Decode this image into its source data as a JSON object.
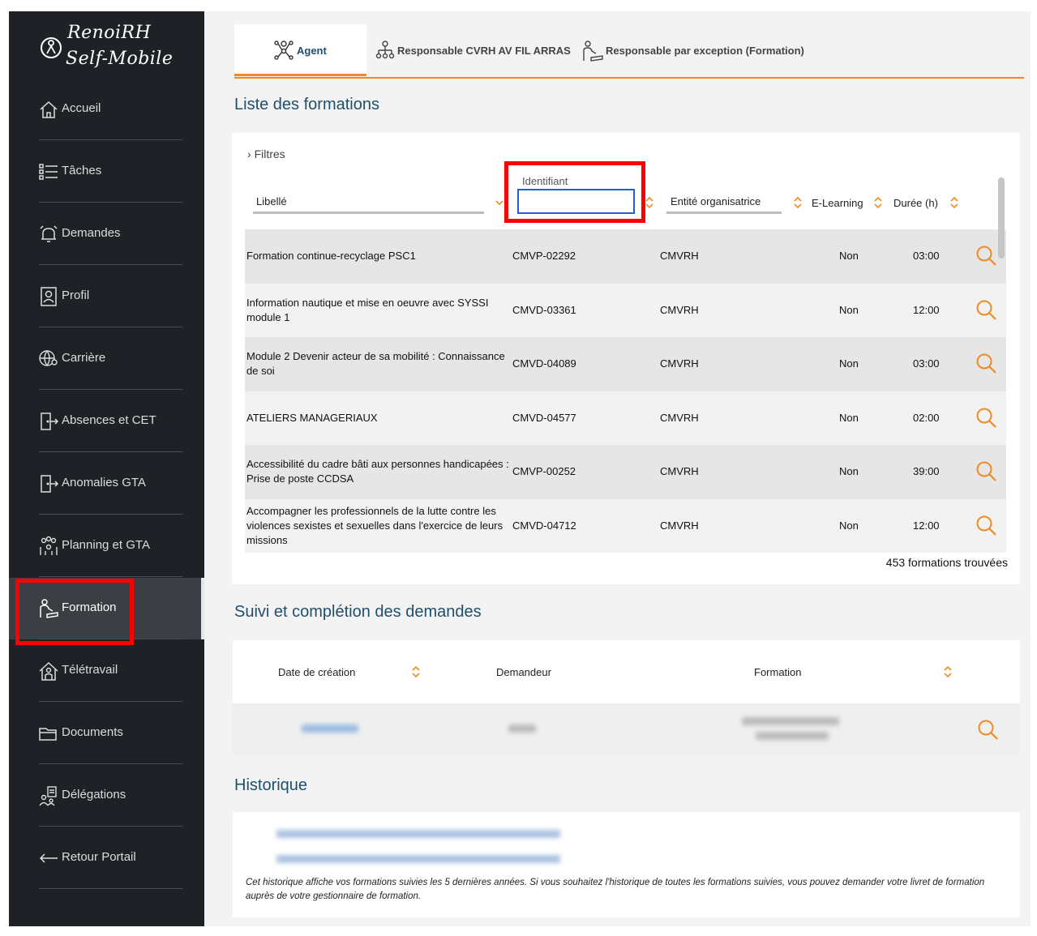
{
  "app": {
    "logo_line1": "RenoiRH",
    "logo_line2": "Self-Mobile"
  },
  "sidebar": {
    "items": [
      {
        "label": "Accueil",
        "icon": "home-icon"
      },
      {
        "label": "Tâches",
        "icon": "list-icon"
      },
      {
        "label": "Demandes",
        "icon": "bell-icon"
      },
      {
        "label": "Profil",
        "icon": "profile-icon"
      },
      {
        "label": "Carrière",
        "icon": "globe-user-icon"
      },
      {
        "label": "Absences et CET",
        "icon": "door-exit-icon"
      },
      {
        "label": "Anomalies GTA",
        "icon": "door-exit-icon"
      },
      {
        "label": "Planning et GTA",
        "icon": "group-icon"
      },
      {
        "label": "Formation",
        "icon": "person-study-icon"
      },
      {
        "label": "Télétravail",
        "icon": "home-person-icon"
      },
      {
        "label": "Documents",
        "icon": "folder-icon"
      },
      {
        "label": "Délégations",
        "icon": "delegation-icon"
      },
      {
        "label": "Retour Portail",
        "icon": "arrow-left-icon"
      }
    ],
    "active": "Formation"
  },
  "tabs": [
    {
      "label": "Agent",
      "active": true
    },
    {
      "label": "Responsable CVRH AV FIL ARRAS",
      "active": false
    },
    {
      "label": "Responsable par exception (Formation)",
      "active": false
    }
  ],
  "formations": {
    "title": "Liste des formations",
    "filters_label": "Filtres",
    "columns": {
      "libelle": "Libellé",
      "identifiant": "Identifiant",
      "entite": "Entité organisatrice",
      "elearning": "E-Learning",
      "duree": "Durée (h)"
    },
    "identifiant_value": "",
    "rows": [
      {
        "libelle": "Formation continue-recyclage PSC1",
        "id": "CMVP-02292",
        "entite": "CMVRH",
        "elearning": "Non",
        "duree": "03:00"
      },
      {
        "libelle": "Information nautique et mise en oeuvre avec SYSSI module 1",
        "id": "CMVD-03361",
        "entite": "CMVRH",
        "elearning": "Non",
        "duree": "12:00"
      },
      {
        "libelle": "Module 2 Devenir acteur de sa mobilité : Connaissance de soi",
        "id": "CMVD-04089",
        "entite": "CMVRH",
        "elearning": "Non",
        "duree": "03:00"
      },
      {
        "libelle": "ATELIERS MANAGERIAUX",
        "id": "CMVD-04577",
        "entite": "CMVRH",
        "elearning": "Non",
        "duree": "02:00"
      },
      {
        "libelle": "Accessibilité du cadre bâti aux personnes handicapées : Prise de poste CCDSA",
        "id": "CMVP-00252",
        "entite": "CMVRH",
        "elearning": "Non",
        "duree": "39:00"
      },
      {
        "libelle": "Accompagner les professionnels de la lutte contre les violences sexistes et sexuelles dans l'exercice de leurs missions",
        "id": "CMVD-04712",
        "entite": "CMVRH",
        "elearning": "Non",
        "duree": "12:00"
      }
    ],
    "count_text": "453 formations trouvées"
  },
  "suivi": {
    "title": "Suivi et complétion des demandes",
    "columns": {
      "date": "Date de création",
      "demandeur": "Demandeur",
      "formation": "Formation"
    }
  },
  "historique": {
    "title": "Historique",
    "note": "Cet historique affiche vos formations suivies les 5 dernières années. Si vous souhaitez l'historique de toutes les formations suivies, vous pouvez demander votre livret de formation auprès de votre gestionnaire de formation."
  },
  "colors": {
    "accent": "#f08a24",
    "title": "#1f4f6b",
    "sidebar": "#1e2125",
    "highlight": "#ff0000"
  }
}
